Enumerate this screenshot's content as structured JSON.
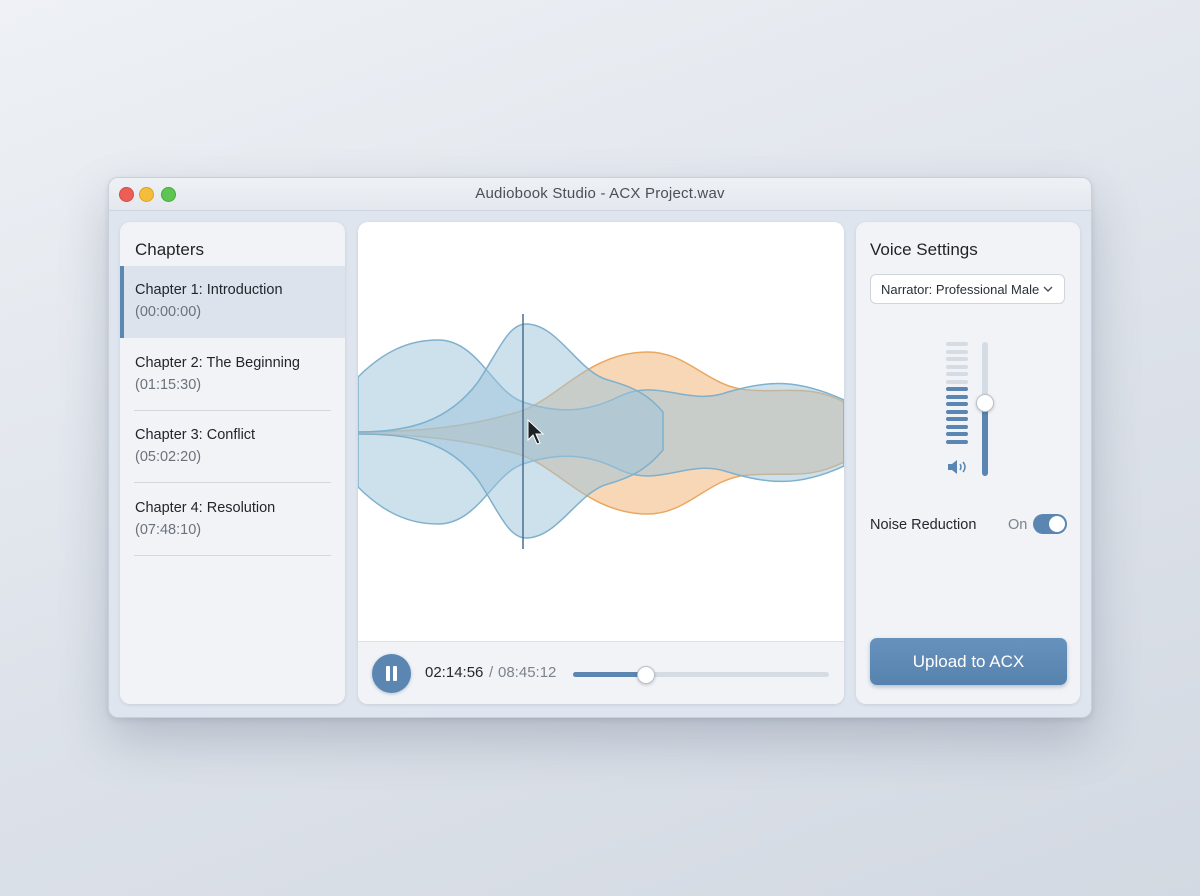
{
  "window": {
    "title": "Audiobook Studio - ACX Project.wav"
  },
  "chapters": {
    "heading": "Chapters",
    "items": [
      {
        "title": "Chapter 1: Introduction",
        "time": "(00:00:00)",
        "active": true
      },
      {
        "title": "Chapter 2: The Beginning",
        "time": "(01:15:30)",
        "active": false
      },
      {
        "title": "Chapter 3: Conflict",
        "time": "(05:02:20)",
        "active": false
      },
      {
        "title": "Chapter 4: Resolution",
        "time": "(07:48:10)",
        "active": false
      }
    ]
  },
  "player": {
    "current_time": "02:14:56",
    "separator": "/",
    "total_time": "08:45:12",
    "progress_fraction": 0.28,
    "playhead_fraction": 0.34,
    "state": "playing",
    "colors": {
      "track_a": "#9cc4dc",
      "track_b": "#f2bd86",
      "accent": "#5a86b1"
    }
  },
  "settings": {
    "heading": "Voice Settings",
    "narrator_selected": "Narrator: Professional Male",
    "volume_level": 0.55,
    "meter_level": 0.6,
    "noise_reduction_label": "Noise Reduction",
    "noise_reduction_state": "On",
    "noise_reduction_enabled": true,
    "upload_label": "Upload to ACX"
  },
  "icons": {
    "pause": "pause-icon",
    "dropdown": "chevron-down-icon",
    "speaker": "speaker-icon",
    "cursor": "mouse-pointer-icon"
  }
}
